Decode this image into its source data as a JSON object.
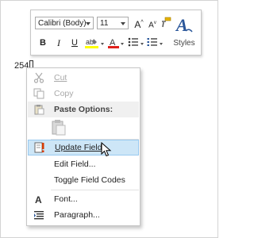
{
  "toolbar": {
    "font_name": "Calibri (Body)",
    "font_size": "11",
    "grow_font_label": "A",
    "shrink_font_label": "A",
    "bold_label": "B",
    "italic_label": "I",
    "underline_label": "U",
    "font_color_label": "A",
    "styles_label": "Styles",
    "colors": {
      "highlight": "#ffff00",
      "font_color": "#e0201b",
      "styles_accent": "#2b579a"
    }
  },
  "document": {
    "page_number_text": "254"
  },
  "context_menu": {
    "items": [
      {
        "label": "Cut",
        "icon": "scissors-icon",
        "state": "disabled"
      },
      {
        "label": "Copy",
        "icon": "copy-icon",
        "state": "disabled"
      },
      {
        "label": "Paste Options:",
        "icon": "paste-icon",
        "state": "header"
      },
      {
        "label": "Update Field",
        "icon": "update-field-icon",
        "state": "highlighted"
      },
      {
        "label": "Edit Field...",
        "icon": "",
        "state": "normal"
      },
      {
        "label": "Toggle Field Codes",
        "icon": "",
        "state": "normal"
      },
      {
        "label": "Font...",
        "icon": "font-icon",
        "state": "normal"
      },
      {
        "label": "Paragraph...",
        "icon": "paragraph-icon",
        "state": "normal"
      }
    ],
    "colors": {
      "highlight_bg": "#cde6f7",
      "highlight_border": "#99c9ef",
      "disabled_text": "#a9a9a9"
    }
  }
}
